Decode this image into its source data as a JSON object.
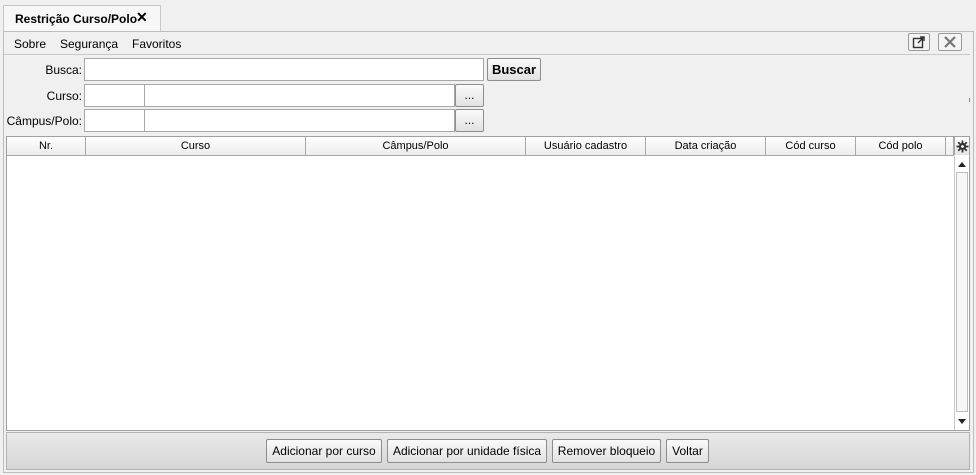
{
  "tab": {
    "title": "Restrição Curso/Polo",
    "close_glyph": "✕"
  },
  "menu": {
    "items": [
      "Sobre",
      "Segurança",
      "Favoritos"
    ]
  },
  "window_controls": {
    "popout": "popout-icon",
    "close": "close-icon"
  },
  "form": {
    "busca_label": "Busca:",
    "busca_value": "",
    "buscar_button": "Buscar",
    "curso_label": "Curso:",
    "curso_code": "",
    "curso_name": "",
    "campus_label": "Câmpus/Polo:",
    "campus_code": "",
    "campus_name": "",
    "lookup_button": "..."
  },
  "table": {
    "columns": [
      "Nr.",
      "Curso",
      "Câmpus/Polo",
      "Usuário cadastro",
      "Data criação",
      "Cód curso",
      "Cód polo"
    ],
    "rows": [],
    "settings_icon": "gear-icon"
  },
  "footer": {
    "add_by_course": "Adicionar por curso",
    "add_by_unit": "Adicionar por unidade física",
    "remove_block": "Remover bloqueio",
    "back": "Voltar"
  }
}
